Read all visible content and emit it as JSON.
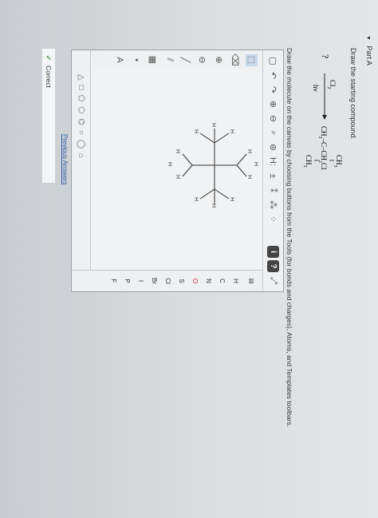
{
  "part": {
    "label": "Part A"
  },
  "question": {
    "instruction": "Draw the starting compound.",
    "reaction": {
      "reactant": "?",
      "reagent_top": "Cl",
      "reagent_top_sub": "2",
      "reagent_bottom": "hv",
      "product_top": "CH",
      "product_top_sub": "3",
      "product_left": "CH",
      "product_left_sub": "3",
      "product_dash": "–C–CH",
      "product_right_sub": "2",
      "product_right_tail": "Cl",
      "product_bottom": "CH",
      "product_bottom_sub": "3"
    }
  },
  "editor": {
    "instruction": "Draw the molecule on the canvas by choosing buttons from the Tools (for bonds and charges), Atoms, and Templates toolbars.",
    "top_tools": [
      "H:",
      "±"
    ],
    "right_atoms": [
      "H",
      "C",
      "N",
      "O",
      "S",
      "Cl",
      "Br",
      "I",
      "P",
      "F"
    ],
    "canvas_h": [
      "H",
      "H",
      "H",
      "H",
      "H",
      "H",
      "H",
      "H",
      "H",
      "H",
      "H",
      "H"
    ]
  },
  "previous_answers": "Previous Answers",
  "status": {
    "text": "Correct"
  }
}
